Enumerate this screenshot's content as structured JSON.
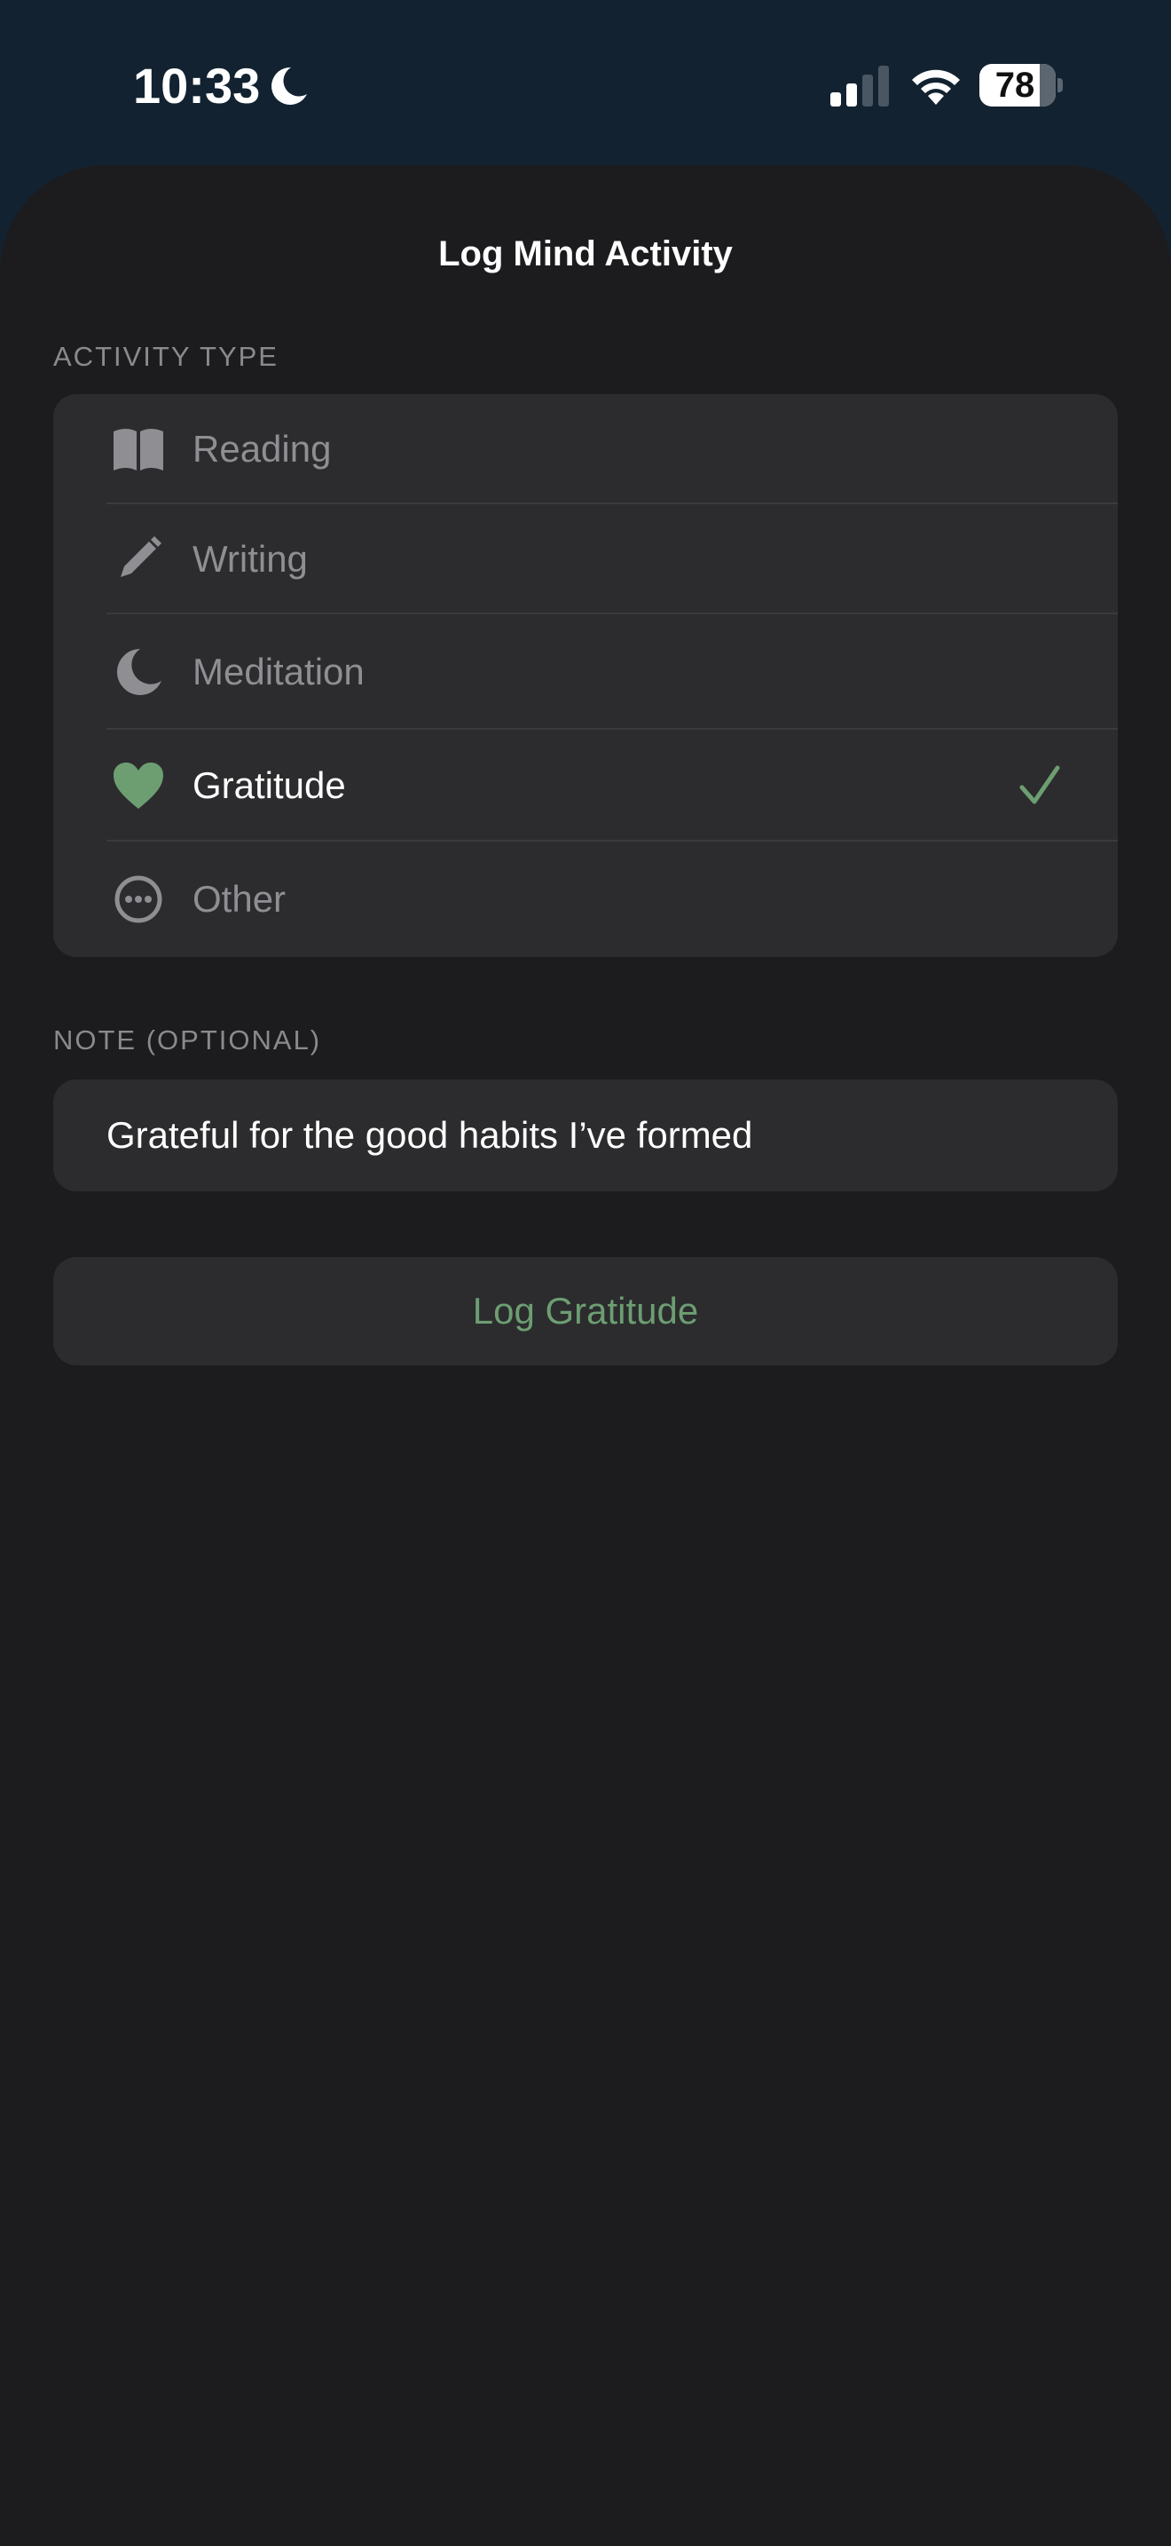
{
  "status_bar": {
    "time": "10:33",
    "battery_level": "78",
    "icons": [
      "moon-icon",
      "cellular-signal-icon",
      "wifi-icon",
      "battery-icon"
    ]
  },
  "sheet": {
    "title": "Log Mind Activity"
  },
  "activity_section": {
    "header": "ACTIVITY TYPE",
    "items": [
      {
        "label": "Reading",
        "icon": "book-icon",
        "selected": false
      },
      {
        "label": "Writing",
        "icon": "pencil-icon",
        "selected": false
      },
      {
        "label": "Meditation",
        "icon": "moon-icon",
        "selected": false
      },
      {
        "label": "Gratitude",
        "icon": "heart-icon",
        "selected": true
      },
      {
        "label": "Other",
        "icon": "ellipsis-circle-icon",
        "selected": false
      }
    ]
  },
  "note_section": {
    "header": "NOTE (OPTIONAL)",
    "value": "Grateful for the good habits I’ve formed"
  },
  "action": {
    "log_button_label": "Log Gratitude"
  },
  "colors": {
    "accent": "#6c9e72",
    "sheet_background": "#1c1c1e",
    "group_background": "#2c2c2e",
    "secondary_text": "#8e8e93"
  }
}
